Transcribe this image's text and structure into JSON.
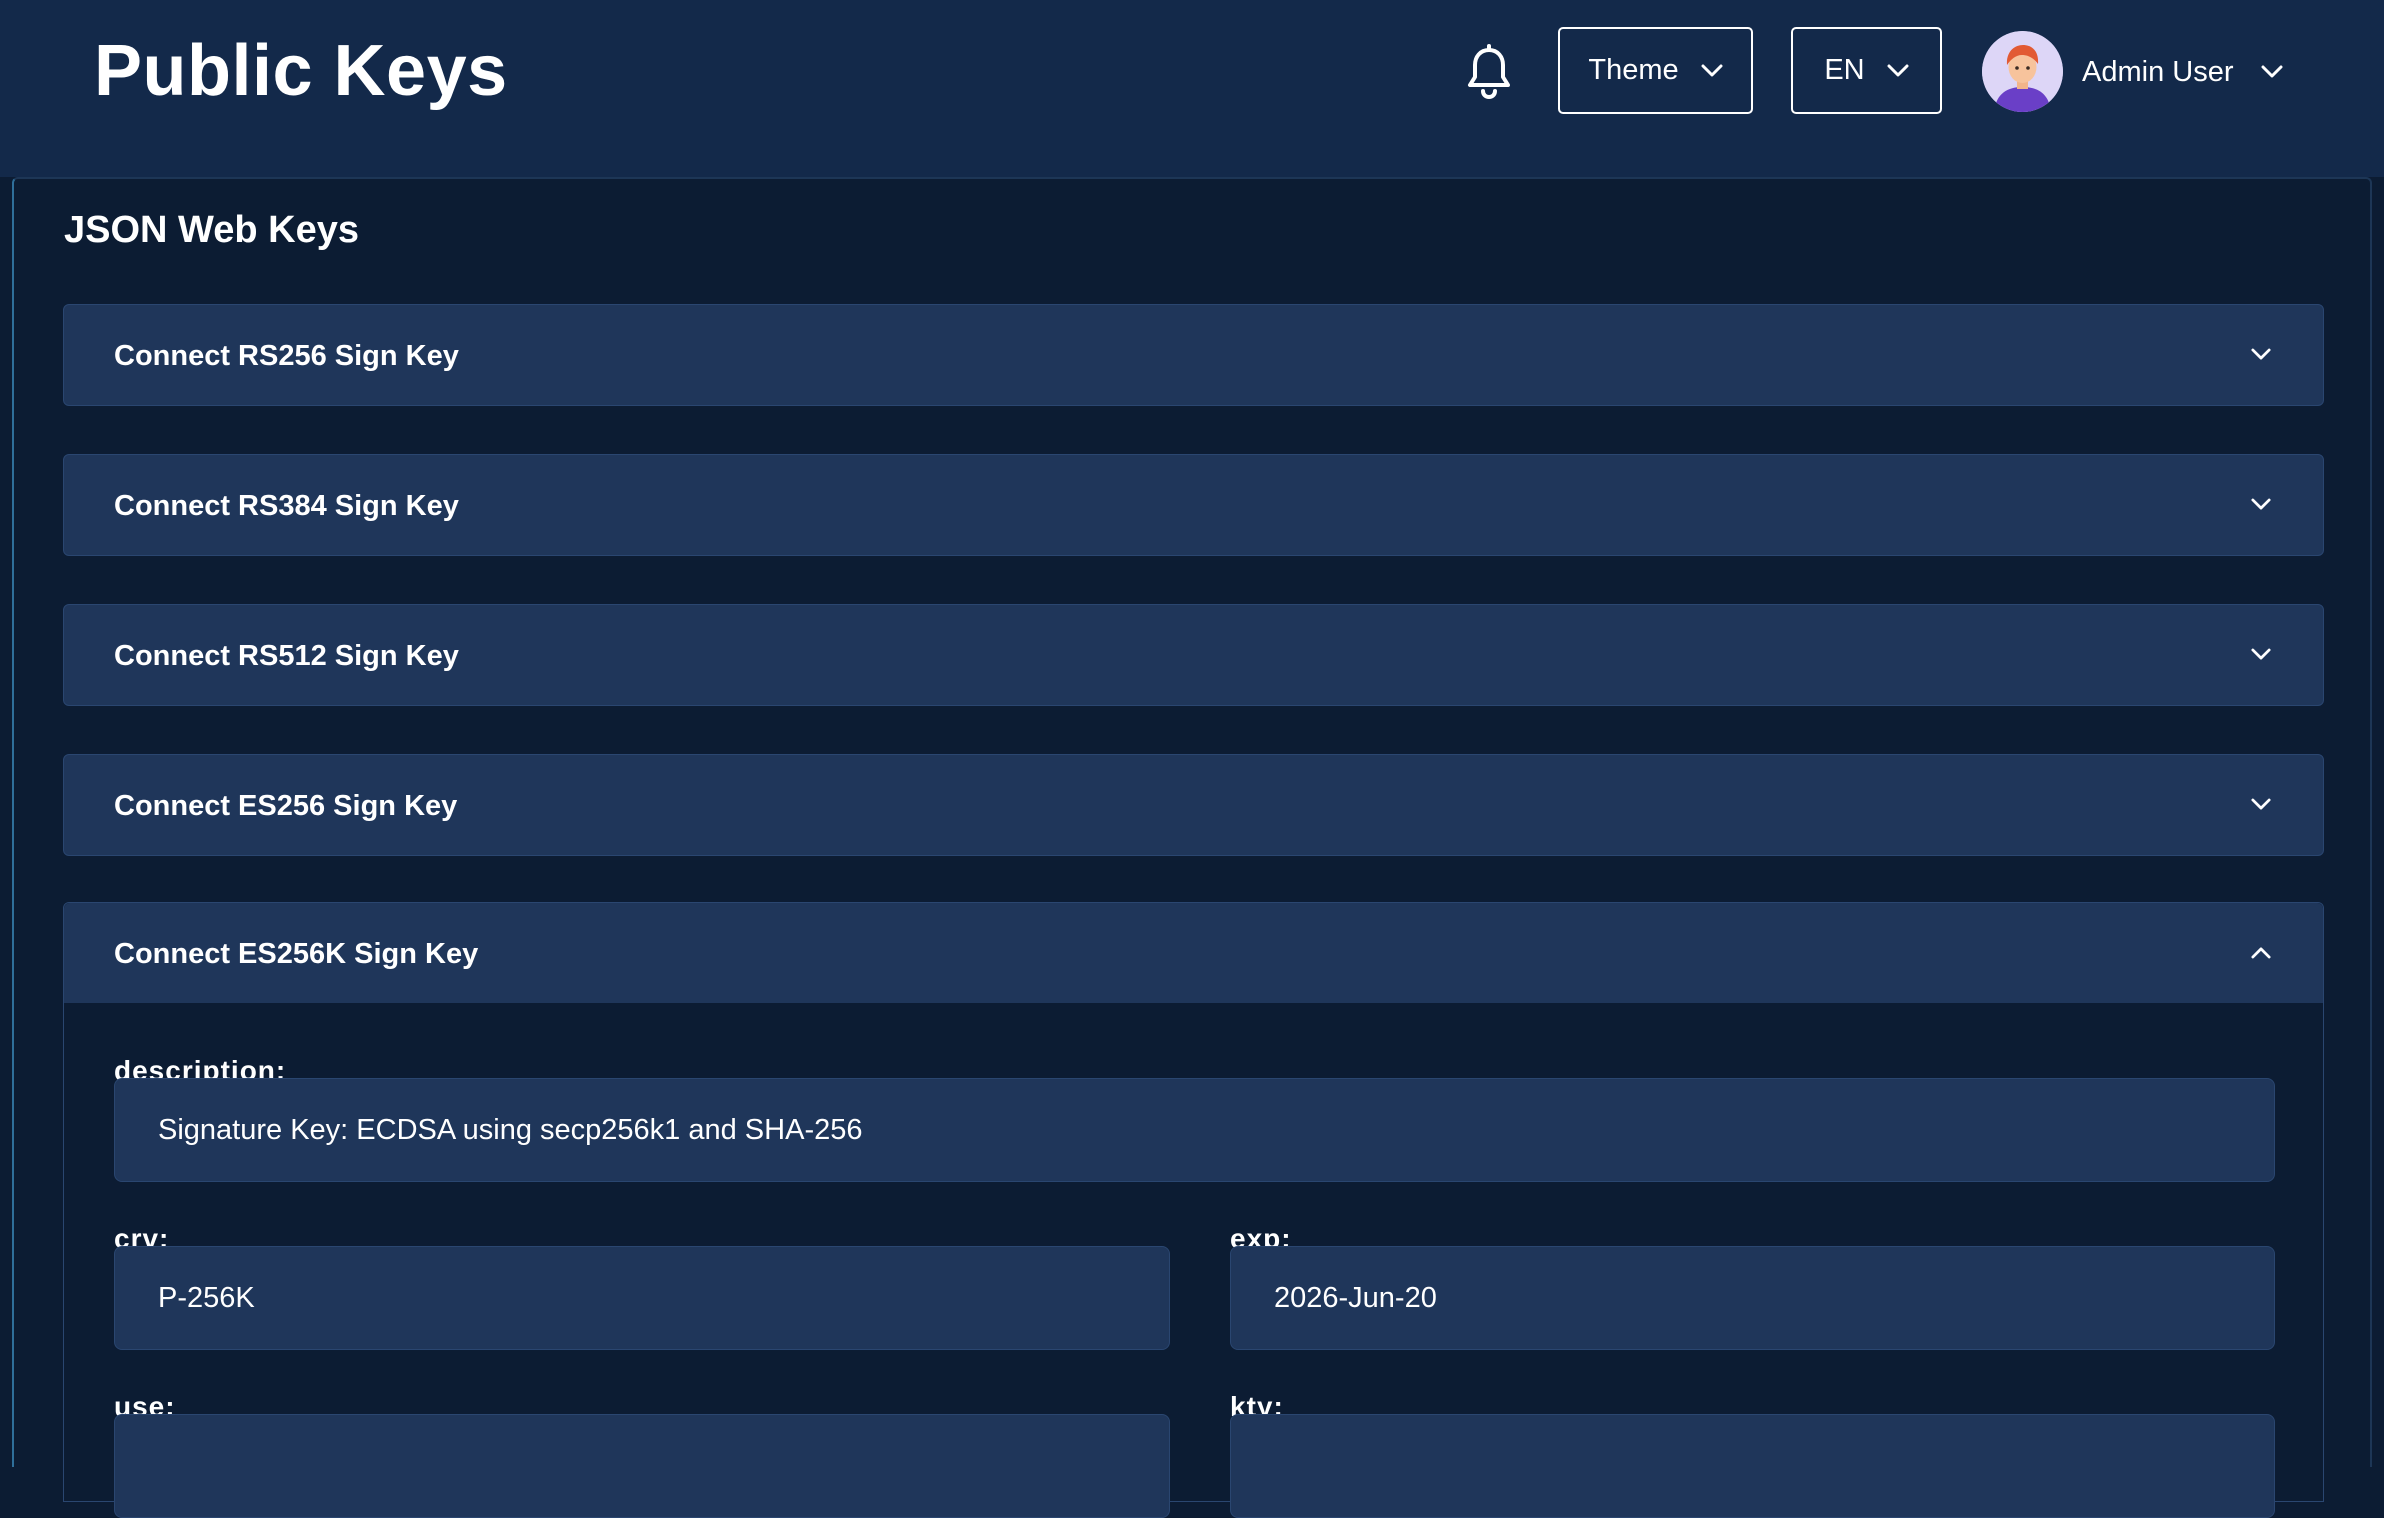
{
  "header": {
    "title": "Public Keys",
    "theme_label": "Theme",
    "language_label": "EN",
    "user_name": "Admin User"
  },
  "main": {
    "section_title": "JSON Web Keys",
    "keys": [
      {
        "label": "Connect RS256 Sign Key",
        "expanded": false
      },
      {
        "label": "Connect RS384 Sign Key",
        "expanded": false
      },
      {
        "label": "Connect RS512 Sign Key",
        "expanded": false
      },
      {
        "label": "Connect ES256 Sign Key",
        "expanded": false
      },
      {
        "label": "Connect ES256K Sign Key",
        "expanded": true
      }
    ],
    "expanded_key": {
      "description_label": "description:",
      "description_value": "Signature Key: ECDSA using secp256k1 and SHA-256",
      "crv_label": "crv:",
      "crv_value": "P-256K",
      "exp_label": "exp:",
      "exp_value": "2026-Jun-20",
      "use_label": "use:",
      "kty_label": "kty:"
    }
  },
  "icons": {
    "bell": "bell-icon",
    "chevron_down": "chevron-down-icon",
    "chevron_up": "chevron-up-icon",
    "avatar": "user-avatar"
  },
  "colors": {
    "header_bg": "#13294a",
    "page_bg": "#0c1c33",
    "accordion_bg": "#1f365a",
    "accent_border": "#2f6f9a"
  }
}
